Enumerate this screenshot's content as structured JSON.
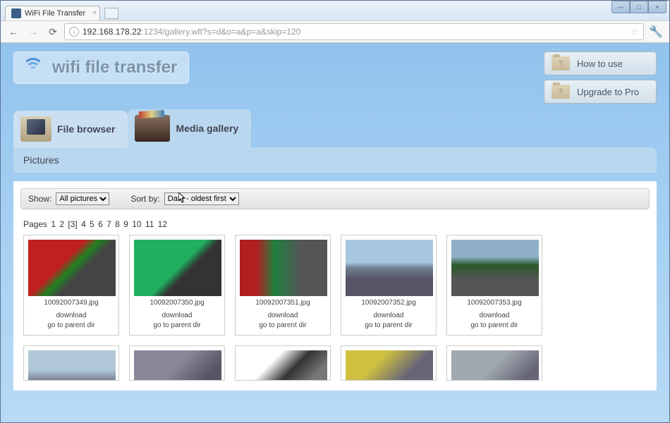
{
  "window": {
    "title": "WiFi File Transfer",
    "url_ip": "192.168.178.22",
    "url_rest": ":1234/gallery.wft?s=d&o=a&p=a&skip=120"
  },
  "app": {
    "logo_text": "wifi file transfer"
  },
  "side_buttons": {
    "howto": "How to use",
    "upgrade": "Upgrade to Pro"
  },
  "tabs": {
    "file_browser": "File browser",
    "media_gallery": "Media gallery"
  },
  "subheader": {
    "path": "Pictures"
  },
  "filters": {
    "show_label": "Show:",
    "show_value": "All pictures",
    "sort_label": "Sort by:",
    "sort_value": "Date - oldest first"
  },
  "pagination": {
    "label": "Pages",
    "current": 3,
    "pages": [
      "1",
      "2",
      "[3]",
      "4",
      "5",
      "6",
      "7",
      "8",
      "9",
      "10",
      "11",
      "12"
    ]
  },
  "thumb_actions": {
    "download": "download",
    "parent": "go to parent dir"
  },
  "thumbs": [
    {
      "name": "10092007349.jpg",
      "class": "t1"
    },
    {
      "name": "10092007350.jpg",
      "class": "t2"
    },
    {
      "name": "10092007351.jpg",
      "class": "t3"
    },
    {
      "name": "10092007352.jpg",
      "class": "t4"
    },
    {
      "name": "10092007353.jpg",
      "class": "t5"
    },
    {
      "name": "",
      "class": "t6"
    },
    {
      "name": "",
      "class": "t7"
    },
    {
      "name": "",
      "class": "t8"
    },
    {
      "name": "",
      "class": "t9"
    },
    {
      "name": "",
      "class": "t10"
    }
  ]
}
